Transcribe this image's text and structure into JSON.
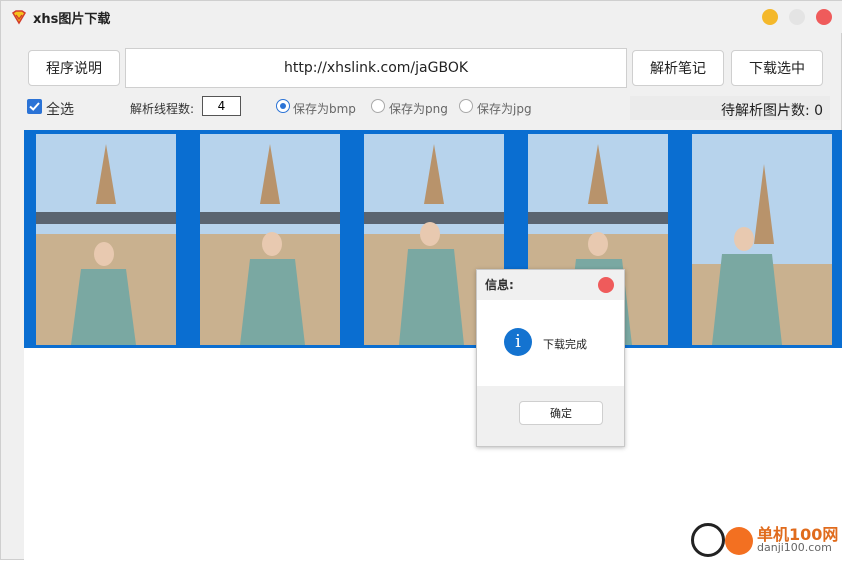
{
  "window": {
    "title": "xhs图片下载"
  },
  "toolbar": {
    "help_label": "程序说明",
    "url_value": "http://xhslink.com/jaGBOK",
    "parse_label": "解析笔记",
    "download_label": "下载选中"
  },
  "options": {
    "select_all_label": "全选",
    "select_all_checked": true,
    "threads_label": "解析线程数:",
    "threads_value": "4",
    "radios": [
      {
        "label": "保存为bmp",
        "selected": true
      },
      {
        "label": "保存为png",
        "selected": false
      },
      {
        "label": "保存为jpg",
        "selected": false
      }
    ],
    "pending_text": "待解析图片数:  0"
  },
  "gallery": {
    "thumbnail_count": 5,
    "accent": "#0a6ed1"
  },
  "dialog": {
    "title": "信息:",
    "message": "下载完成",
    "ok_label": "确定",
    "icon": "info-icon"
  },
  "watermark": {
    "name": "单机100网",
    "url": "danji100.com"
  },
  "colors": {
    "accent": "#2b73d6",
    "close": "#ef5b5b",
    "minimize": "#f4b82b"
  }
}
